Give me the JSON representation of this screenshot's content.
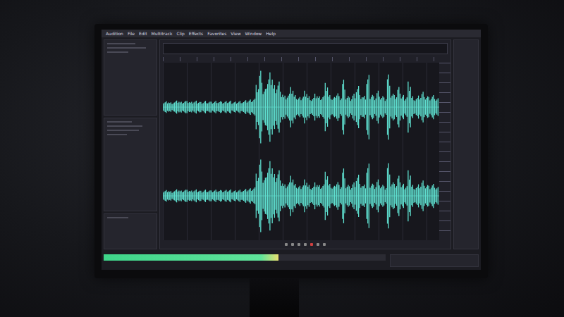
{
  "app": {
    "menu": [
      {
        "label": "Audition"
      },
      {
        "label": "File"
      },
      {
        "label": "Edit"
      },
      {
        "label": "Multitrack"
      },
      {
        "label": "Clip"
      },
      {
        "label": "Effects"
      },
      {
        "label": "Favorites"
      },
      {
        "label": "View"
      },
      {
        "label": "Window"
      },
      {
        "label": "Help"
      }
    ]
  },
  "waveform": {
    "envelope": [
      0.14,
      0.16,
      0.13,
      0.15,
      0.17,
      0.14,
      0.16,
      0.15,
      0.13,
      0.16,
      0.15,
      0.14,
      0.17,
      0.15,
      0.14,
      0.16,
      0.15,
      0.13,
      0.15,
      0.16,
      0.14,
      0.15,
      0.17,
      0.16,
      0.18,
      0.2,
      0.22,
      0.55,
      0.9,
      0.45,
      0.8,
      0.95,
      0.6,
      0.7,
      0.4,
      0.3,
      0.35,
      0.5,
      0.3,
      0.25,
      0.3,
      0.45,
      0.3,
      0.25,
      0.35,
      0.28,
      0.3,
      0.6,
      0.3,
      0.25,
      0.4,
      0.3,
      0.75,
      0.3,
      0.25,
      0.35,
      0.55,
      0.3,
      0.28,
      0.8,
      0.35,
      0.3,
      0.45,
      0.3,
      0.25,
      0.85,
      0.35,
      0.3,
      0.5,
      0.3,
      0.28,
      0.7,
      0.3,
      0.25,
      0.3,
      0.4,
      0.28,
      0.25,
      0.3,
      0.22
    ]
  },
  "level_meter": {
    "level": 0.62
  }
}
